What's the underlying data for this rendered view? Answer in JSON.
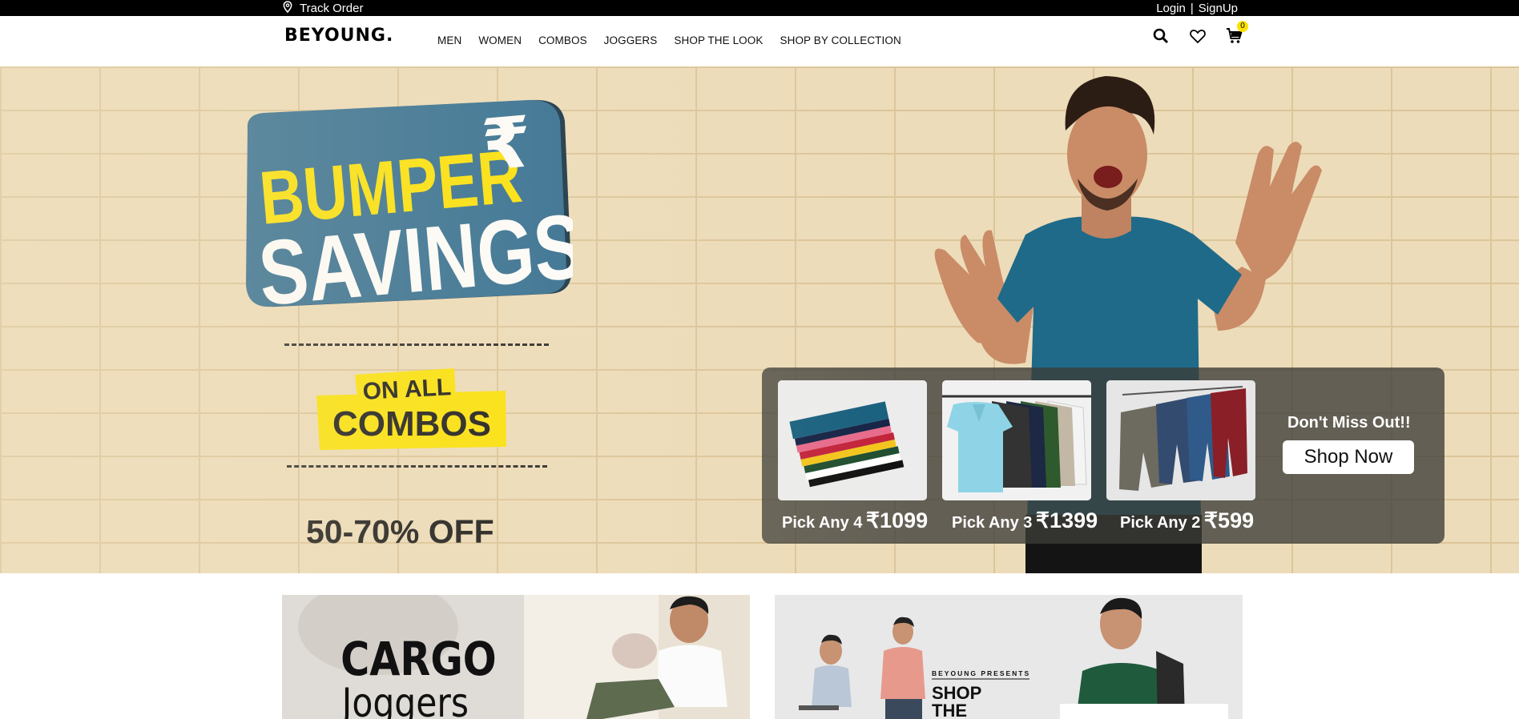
{
  "topbar": {
    "track_order": "Track Order",
    "login": "Login",
    "separator": "|",
    "signup": "SignUp"
  },
  "header": {
    "logo": "BEYOUNG.",
    "nav": [
      "MEN",
      "WOMEN",
      "COMBOS",
      "JOGGERS",
      "SHOP THE LOOK",
      "SHOP BY COLLECTION"
    ],
    "cart_count": "0"
  },
  "hero": {
    "headline_1": "BUMPER",
    "rupee": "₹",
    "headline_2": "SAVINGS",
    "on_all": "ON ALL",
    "combos": "COMBOS",
    "discount": "50-70% OFF",
    "offers": [
      {
        "label": "Pick Any 4",
        "price": "₹1099"
      },
      {
        "label": "Pick Any 3",
        "price": "₹1399"
      },
      {
        "label": "Pick Any 2",
        "price": "₹599"
      }
    ],
    "cta_heading": "Don't Miss Out!!",
    "cta_button": "Shop Now"
  },
  "tiles": {
    "cargo_1": "CARGO",
    "cargo_2": "Joggers",
    "presents": "BEYOUNG PRESENTS",
    "shop_1": "SHOP",
    "shop_2": "THE"
  },
  "colors": {
    "accent_yellow": "#fce200",
    "badge_blue": "#2b6a90",
    "panel": "#3c3c37"
  }
}
